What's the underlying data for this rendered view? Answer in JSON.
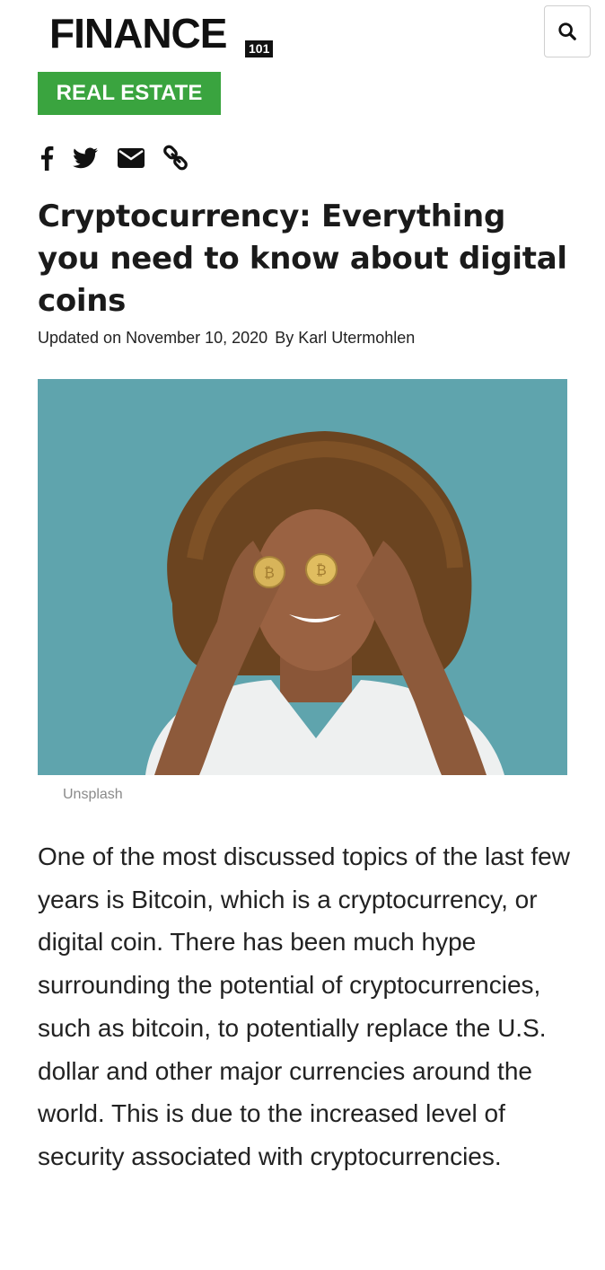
{
  "header": {
    "logo_text": "FINANCE",
    "logo_badge": "101",
    "search_icon": "search-icon"
  },
  "category": {
    "label": "REAL ESTATE",
    "color": "#3aa43f"
  },
  "share": {
    "icons": [
      "facebook-icon",
      "twitter-icon",
      "email-icon",
      "link-icon"
    ]
  },
  "article": {
    "title": "Cryptocurrency: Everything you need to know about digital coins",
    "updated": "Updated on November 10, 2020",
    "author": "By Karl Utermohlen",
    "image_caption": "Unsplash",
    "body": "One of the most discussed topics of the last few years is Bitcoin, which is a cryptocurrency, or digital coin. There has been much hype surrounding the potential of cryptocurrencies, such as bitcoin, to potentially replace the U.S. dollar and other major currencies around the world. This is due to the increased level of security associated with cryptocurrencies."
  },
  "colors": {
    "image_background": "#5fa4ad",
    "accent": "#3aa43f"
  }
}
